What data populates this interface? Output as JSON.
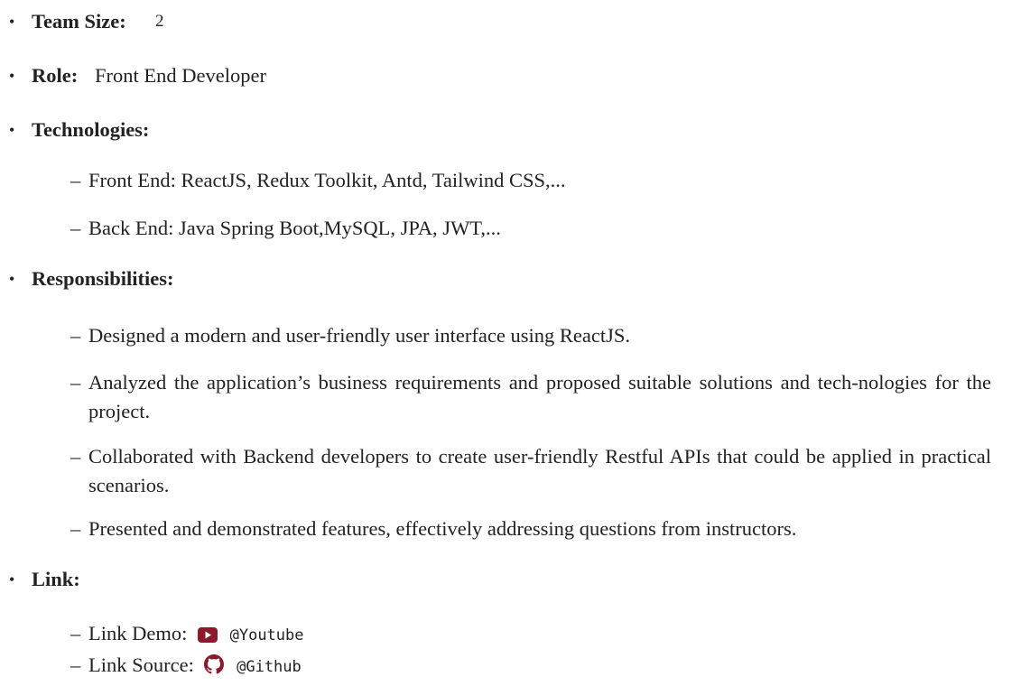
{
  "team_size": {
    "label": "Team Size:",
    "value": "2"
  },
  "role": {
    "label": "Role:",
    "value": "Front End Developer"
  },
  "technologies": {
    "label": "Technologies:",
    "items": [
      "Front End: ReactJS, Redux Toolkit, Antd, Tailwind CSS,...",
      "Back End: Java Spring Boot,MySQL, JPA, JWT,..."
    ]
  },
  "responsibilities": {
    "label": "Responsibilities:",
    "items": [
      "Designed a modern and user-friendly user interface using ReactJS.",
      "Analyzed the application’s business requirements and proposed suitable solutions and tech-nologies for the project.",
      "Collaborated with Backend developers to create user-friendly Restful APIs that could be applied in practical scenarios.",
      "Presented and demonstrated features, effectively addressing questions from instructors."
    ]
  },
  "link": {
    "label": "Link:",
    "demo_label": "Link Demo:",
    "demo_text": "@Youtube",
    "demo_icon": "youtube-icon",
    "source_label": "Link Source:",
    "source_text": "@Github",
    "source_icon": "github-icon"
  },
  "colors": {
    "text": "#222222",
    "youtube_icon": "#8b1a2c"
  },
  "bullet_char": "•",
  "dash_char": "–"
}
